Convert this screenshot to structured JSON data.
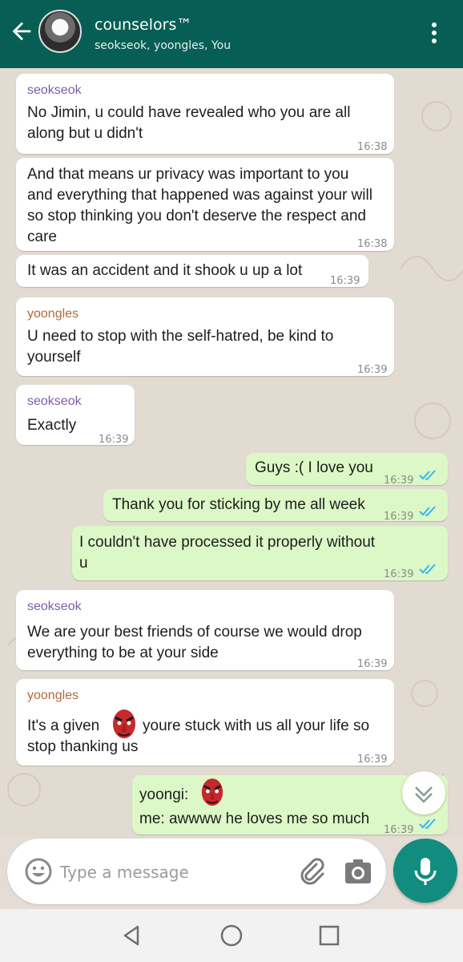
{
  "header": {
    "title": "counselors™",
    "subtitle": "seokseok, yoongles, You",
    "colors": {
      "bar": "#075e54",
      "mic": "#128c7e",
      "outgoing": "#dcf8c6"
    }
  },
  "messages": {
    "m1": {
      "sender": "seokseok",
      "line1": "No Jimin, u could have revealed who you are all",
      "line2": "along but u didn't",
      "time": "16:38"
    },
    "m2": {
      "line1": "And that means ur privacy was important to you",
      "line2": "and everything that happened was against your will",
      "line3": "so stop thinking you don't deserve the respect and",
      "line4": "care",
      "time": "16:38"
    },
    "m3": {
      "line1": "It was an accident and it shook u up a lot",
      "time": "16:39"
    },
    "m4": {
      "sender": "yoongles",
      "line1": "U need to stop with the self-hatred, be kind to",
      "line2": "yourself",
      "time": "16:39"
    },
    "m5": {
      "sender": "seokseok",
      "line1": "Exactly",
      "time": "16:39"
    },
    "m6": {
      "line1": "Guys :( I love you",
      "time": "16:39"
    },
    "m7": {
      "line1": "Thank you for sticking by me all week",
      "time": "16:39"
    },
    "m8": {
      "line1": "I couldn't have processed it properly without",
      "line2": "u",
      "time": "16:39"
    },
    "m9": {
      "sender": "seokseok",
      "line1": "We are your best friends of course we would drop",
      "line2": "everything to be at your side",
      "time": "16:39"
    },
    "m10": {
      "sender": "yoongles",
      "line1a": "It's a given",
      "line1b": "youre stuck with us all your life so",
      "line2": "stop thanking us",
      "time": "16:39"
    },
    "m11": {
      "line1": "yoongi:",
      "line2": "me: awwww he loves me so much",
      "time": "16:39"
    }
  },
  "composer": {
    "placeholder": "Type a message"
  },
  "icons": [
    "back-arrow-icon",
    "avatar",
    "more-vert-icon",
    "emoji-icon",
    "attach-icon",
    "camera-icon",
    "mic-icon",
    "double-check-icon",
    "tengu-mask-emoji",
    "chevron-down-icon",
    "nav-back-icon",
    "nav-home-icon",
    "nav-recents-icon"
  ]
}
